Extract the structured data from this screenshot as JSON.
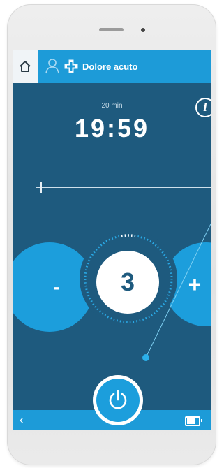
{
  "header": {
    "title": "Dolore acuto",
    "icons": [
      "home-icon",
      "person-icon",
      "medical-cross-icon"
    ]
  },
  "session": {
    "duration": "20 min",
    "remaining": "19:59"
  },
  "intensity": {
    "level": "3",
    "minus_label": "-",
    "plus_label": "+"
  },
  "progress": {
    "value": 0.02
  },
  "footer": {
    "icons": [
      "back-icon",
      "battery-icon"
    ],
    "power_icon": "power-icon"
  },
  "colors": {
    "primary": "#1d9bd8",
    "background": "#1e5a7e",
    "text": "#ffffff"
  }
}
